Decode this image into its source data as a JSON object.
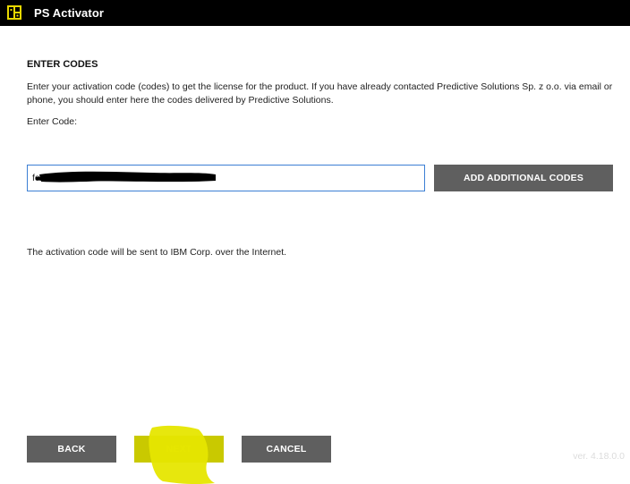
{
  "window": {
    "title": "PS Activator",
    "icon": "ps-activator-icon"
  },
  "content": {
    "heading": "ENTER CODES",
    "description": "Enter your activation code (codes) to get the license for the product. If you have already contacted Predictive Solutions Sp. z o.o. via email or phone, you should enter here the codes delivered by Predictive Solutions.",
    "code_label": "Enter Code:",
    "code_value": "fc0",
    "add_codes_label": "ADD ADDITIONAL CODES",
    "internet_note": "The activation code will be sent to IBM Corp. over the Internet."
  },
  "footer": {
    "back_label": "BACK",
    "next_label": "NEXT",
    "cancel_label": "CANCEL",
    "version": "ver. 4.18.0.0"
  },
  "colors": {
    "titlebar": "#000000",
    "button": "#5f5f5f",
    "input_border": "#3c7fd4",
    "highlight": "#e6e600"
  }
}
